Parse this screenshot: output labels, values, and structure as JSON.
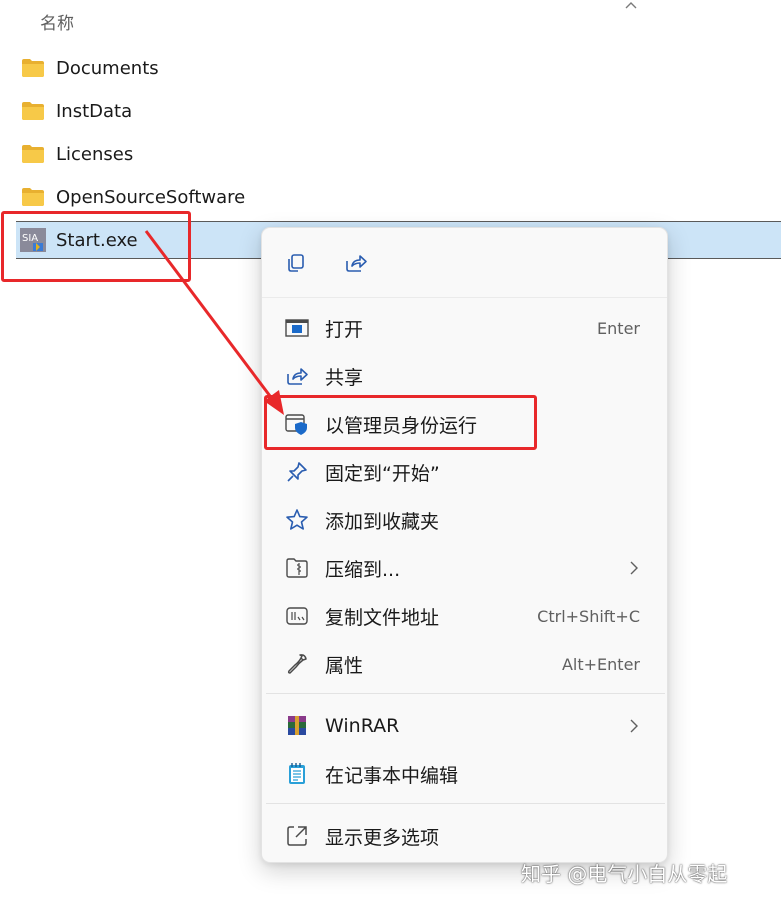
{
  "explorer": {
    "column_header": "名称",
    "files": [
      {
        "name": "Documents",
        "type": "folder"
      },
      {
        "name": "InstData",
        "type": "folder"
      },
      {
        "name": "Licenses",
        "type": "folder"
      },
      {
        "name": "OpenSourceSoftware",
        "type": "folder"
      },
      {
        "name": "Start.exe",
        "type": "exe",
        "selected": true,
        "icon_text": "SIA"
      }
    ]
  },
  "context_menu": {
    "top_actions": [
      {
        "icon": "copy-icon"
      },
      {
        "icon": "share-icon"
      }
    ],
    "items": [
      {
        "label": "打开",
        "shortcut": "Enter",
        "icon": "open-icon"
      },
      {
        "label": "共享",
        "shortcut": "",
        "icon": "share-icon"
      },
      {
        "label": "以管理员身份运行",
        "shortcut": "",
        "icon": "shield-icon",
        "highlighted": true
      },
      {
        "label": "固定到“开始”",
        "shortcut": "",
        "icon": "pin-icon"
      },
      {
        "label": "添加到收藏夹",
        "shortcut": "",
        "icon": "star-icon"
      },
      {
        "label": "压缩到...",
        "shortcut": "",
        "icon": "zip-folder-icon",
        "submenu": true
      },
      {
        "label": "复制文件地址",
        "shortcut": "Ctrl+Shift+C",
        "icon": "copy-path-icon"
      },
      {
        "label": "属性",
        "shortcut": "Alt+Enter",
        "icon": "wrench-icon"
      },
      {
        "label": "WinRAR",
        "shortcut": "",
        "icon": "winrar-icon",
        "submenu": true
      },
      {
        "label": "在记事本中编辑",
        "shortcut": "",
        "icon": "notepad-icon"
      },
      {
        "label": "显示更多选项",
        "shortcut": "",
        "icon": "show-more-icon"
      }
    ]
  },
  "annotations": {
    "highlight_color": "#e8282a"
  },
  "watermark": "知乎 @电气小白从零起",
  "colors": {
    "selection_bg": "#cce4f7",
    "accent_blue": "#1b6ac9",
    "folder_yellow": "#f7c948"
  }
}
